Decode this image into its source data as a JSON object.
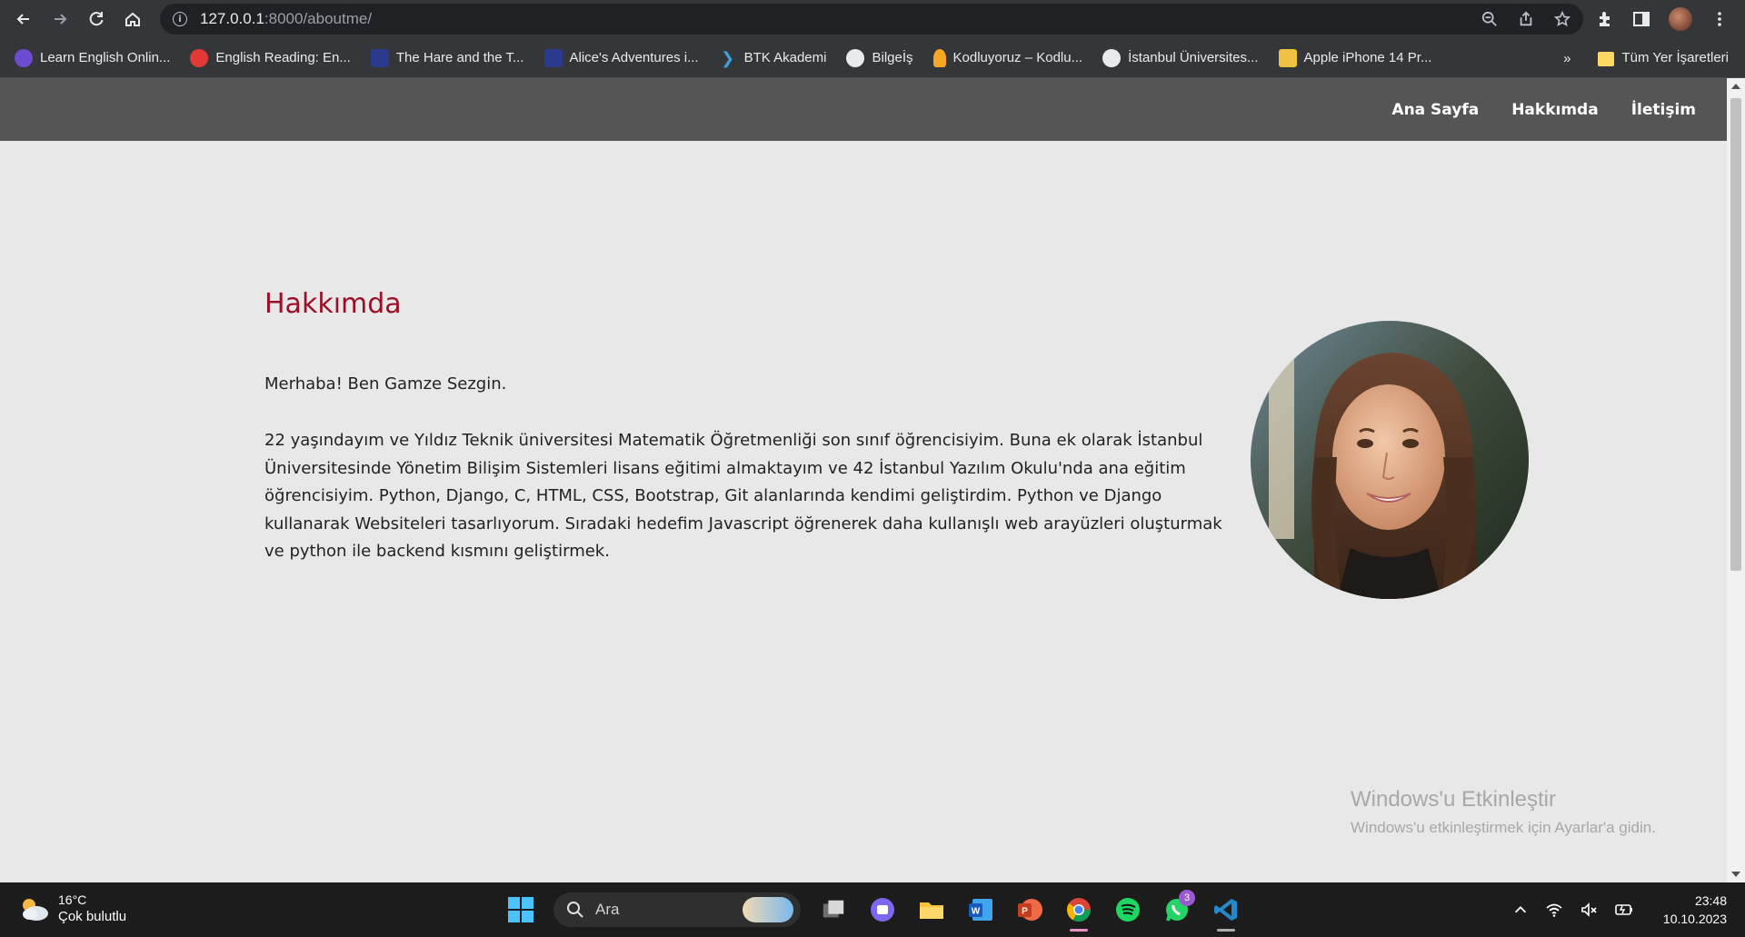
{
  "browser": {
    "url_host": "127.0.0.1",
    "url_path": ":8000/aboutme/",
    "bookmarks": [
      {
        "label": "Learn English Onlin...",
        "color": "#6d4bd0"
      },
      {
        "label": "English Reading: En...",
        "color": "#e53935"
      },
      {
        "label": "The Hare and the T...",
        "color": "#2a3a8c"
      },
      {
        "label": "Alice's Adventures i...",
        "color": "#2a3a8c"
      },
      {
        "label": "BTK Akademi",
        "color": "#3aa0e0"
      },
      {
        "label": "Bilgeİş",
        "color": "#ffffff"
      },
      {
        "label": "Kodluyoruz – Kodlu...",
        "color": "#f5a623"
      },
      {
        "label": "İstanbul Üniversites...",
        "color": "#ffffff"
      },
      {
        "label": "Apple iPhone 14 Pr...",
        "color": "#f0c040"
      }
    ],
    "overflow": "»",
    "all_bookmarks": "Tüm Yer İşaretleri"
  },
  "nav": {
    "home": "Ana Sayfa",
    "about": "Hakkımda",
    "contact": "İletişim"
  },
  "about": {
    "title": "Hakkımda",
    "intro": "Merhaba! Ben Gamze Sezgin.",
    "paragraph": "22 yaşındayım ve Yıldız Teknik üniversitesi Matematik Öğretmenliği son sınıf öğrencisiyim. Buna ek olarak İstanbul Üniversitesinde Yönetim Bilişim Sistemleri lisans eğitimi almaktayım ve 42 İstanbul Yazılım Okulu'nda ana eğitim öğrencisiyim. Python, Django, C, HTML, CSS, Bootstrap, Git alanlarında kendimi geliştirdim. Python ve Django kullanarak Websiteleri tasarlıyorum. Sıradaki hedefim Javascript öğrenerek daha kullanışlı web arayüzleri oluşturmak ve python ile backend kısmını geliştirmek."
  },
  "watermark": {
    "title": "Windows'u Etkinleştir",
    "subtitle": "Windows'u etkinleştirmek için Ayarlar'a gidin."
  },
  "taskbar": {
    "temperature": "16°C",
    "condition": "Çok bulutlu",
    "search_placeholder": "Ara",
    "whatsapp_badge": "3",
    "time": "23:48",
    "date": "10.10.2023"
  }
}
